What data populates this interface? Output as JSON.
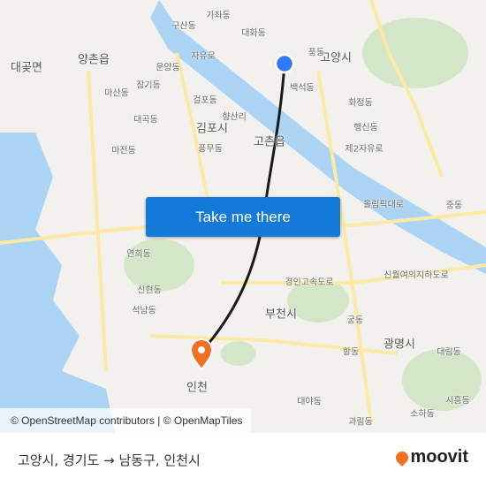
{
  "map": {
    "labels": [
      {
        "text": "대곶면",
        "big": true
      },
      {
        "text": "양촌읍",
        "big": true
      },
      {
        "text": "김포시",
        "big": true
      },
      {
        "text": "고촌읍",
        "big": true
      },
      {
        "text": "고양시",
        "big": true
      },
      {
        "text": "부천시",
        "big": true
      },
      {
        "text": "광명시",
        "big": true
      },
      {
        "text": "인천",
        "big": true
      },
      {
        "text": "가좌동"
      },
      {
        "text": "구산동"
      },
      {
        "text": "대화동"
      },
      {
        "text": "풍동"
      },
      {
        "text": "백석동"
      },
      {
        "text": "운양동"
      },
      {
        "text": "장기동"
      },
      {
        "text": "마산동"
      },
      {
        "text": "걸포동"
      },
      {
        "text": "향산리"
      },
      {
        "text": "풍무동"
      },
      {
        "text": "대곡동"
      },
      {
        "text": "마전동"
      },
      {
        "text": "화정동"
      },
      {
        "text": "행신동"
      },
      {
        "text": "중동"
      },
      {
        "text": "연희동"
      },
      {
        "text": "신현동"
      },
      {
        "text": "석남동"
      },
      {
        "text": "궁동"
      },
      {
        "text": "항동"
      },
      {
        "text": "대림동"
      },
      {
        "text": "대야동"
      },
      {
        "text": "과림동"
      },
      {
        "text": "소하동"
      },
      {
        "text": "시흥동"
      },
      {
        "text": "자유로"
      },
      {
        "text": "제2자유로"
      },
      {
        "text": "경인고속도로"
      },
      {
        "text": "올림픽대로"
      },
      {
        "text": "신월여의지하도로"
      }
    ],
    "colors": {
      "land": "#f2f1ee",
      "water": "#aad3f4",
      "park": "#d4e6c8",
      "road": "#fde9a4",
      "route": "#1a1a1a",
      "origin": "#2f7bf5",
      "destination": "#f36f21"
    },
    "origin_icon": "origin-dot-icon",
    "destination_icon": "destination-pin-icon"
  },
  "cta": {
    "label": "Take me there"
  },
  "attribution": "© OpenStreetMap contributors | © OpenMapTiles",
  "footer": {
    "origin": "고양시, 경기도",
    "arrow": "→",
    "destination": "남동구, 인천시",
    "brand": "moovit"
  }
}
